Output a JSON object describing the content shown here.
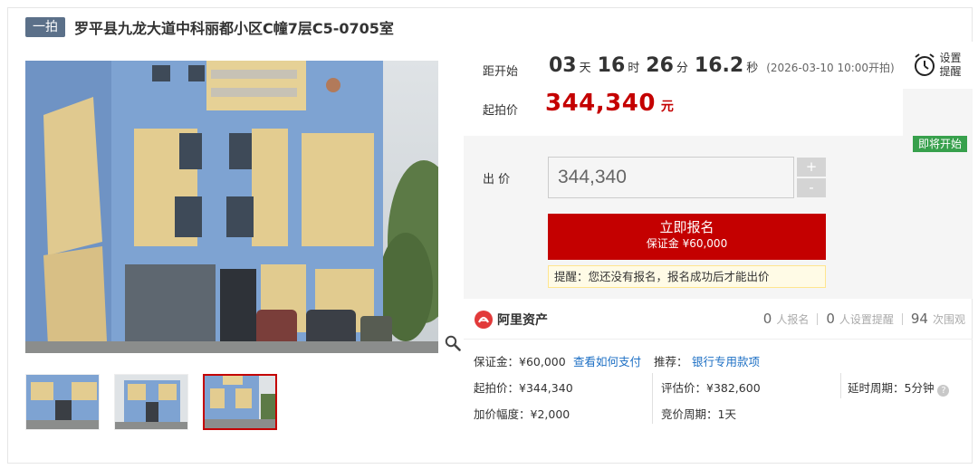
{
  "header": {
    "round_badge": "一拍",
    "title": "罗平县九龙大道中科丽都小区C幢7层C5-0705室"
  },
  "countdown": {
    "label": "距开始",
    "days": "03",
    "days_unit": "天",
    "hours": "16",
    "hours_unit": "时",
    "minutes": "26",
    "minutes_unit": "分",
    "seconds": "16.2",
    "seconds_unit": "秒",
    "start_note": "(2026-03-10 10:00开拍)"
  },
  "reminder": {
    "line1": "设置",
    "line2": "提醒"
  },
  "starting_price": {
    "label": "起拍价",
    "value": "344,340",
    "unit": "元"
  },
  "status_badge": "即将开始",
  "bid": {
    "label": "出 价",
    "value": "344,340",
    "plus": "+",
    "minus": "-"
  },
  "signup": {
    "label": "立即报名",
    "deposit": "保证金 ¥60,000"
  },
  "tip": "提醒：您还没有报名，报名成功后才能出价",
  "platform": {
    "name": "阿里资产",
    "stats": [
      {
        "num": "0",
        "label": "人报名"
      },
      {
        "num": "0",
        "label": "人设置提醒"
      },
      {
        "num": "94",
        "label": "次围观"
      }
    ]
  },
  "details": {
    "deposit": "保证金：¥60,000",
    "how_to_pay": "查看如何支付",
    "recommend_label": "推荐：",
    "recommend_link": "银行专用款项",
    "start_price": "起拍价：¥344,340",
    "appraisal": "评估价：¥382,600",
    "extension": "延时周期：5分钟",
    "increment": "加价幅度：¥2,000",
    "bid_period": "竞价周期：1天"
  },
  "icons": {
    "alarm": "alarm-clock-icon",
    "zoom": "magnifier-icon",
    "help": "question-icon"
  },
  "colors": {
    "accent_red": "#c40000",
    "badge_green": "#37a04c",
    "round_badge": "#5b7089",
    "link_blue": "#1c6fc4"
  }
}
